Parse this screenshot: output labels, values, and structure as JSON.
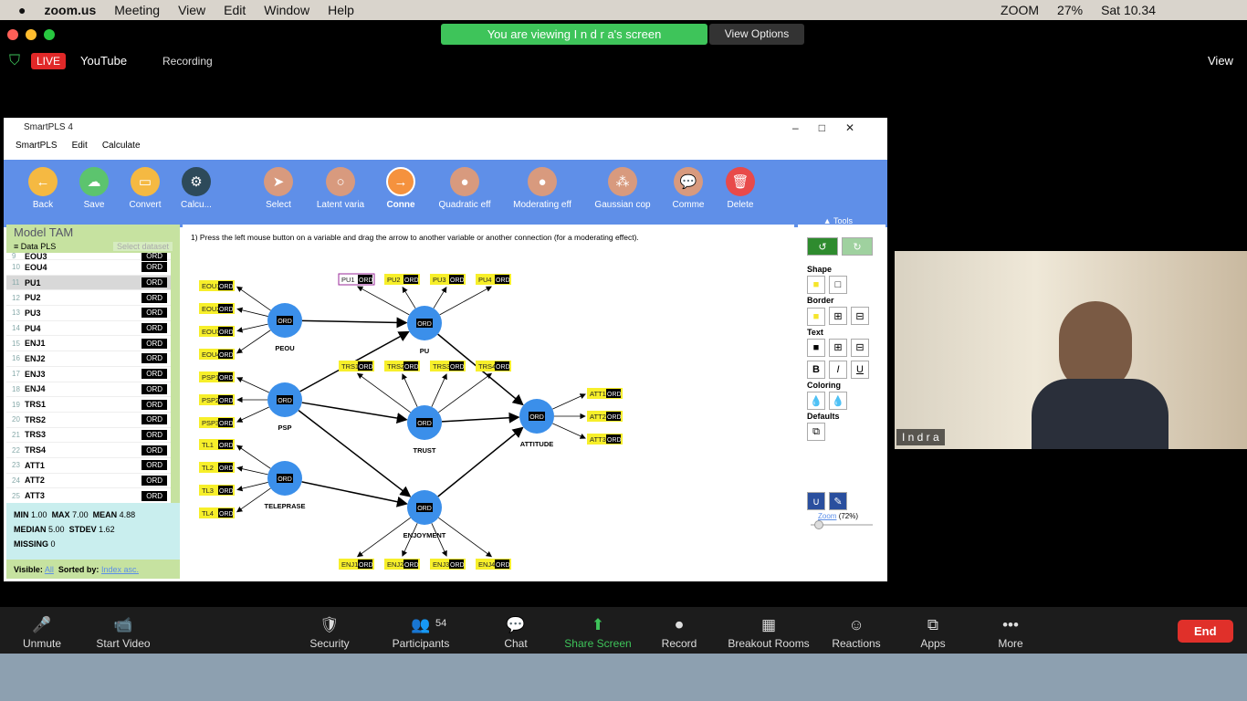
{
  "mac_menu": {
    "app": "zoom.us",
    "items": [
      "Meeting",
      "View",
      "Edit",
      "Window",
      "Help"
    ],
    "status": {
      "zoom": "ZOOM",
      "battery": "27%",
      "time": "Sat 10.34"
    }
  },
  "zoom": {
    "banner": "You are viewing I n d r a's screen",
    "view_options": "View Options",
    "live": "LIVE",
    "stream": "YouTube",
    "recording": "Recording",
    "view": "View",
    "participant": "I n d r a"
  },
  "window": {
    "title": "SmartPLS 4",
    "menu": [
      "SmartPLS",
      "Edit",
      "Calculate"
    ]
  },
  "toolbar": [
    {
      "label": "Back",
      "icon": "arrow-left-icon",
      "color": "#f5b942"
    },
    {
      "label": "Save",
      "icon": "cloud-upload-icon",
      "color": "#5cc46e"
    },
    {
      "label": "Convert",
      "icon": "document-icon",
      "color": "#f5b942"
    },
    {
      "label": "Calcu...",
      "icon": "gear-icon",
      "color": "#2d4a5a"
    },
    {
      "label": "Select",
      "icon": "cursor-icon",
      "color": "#d89a7e"
    },
    {
      "label": "Latent varia",
      "icon": "circle-icon",
      "color": "#d89a7e"
    },
    {
      "label": "Conne",
      "icon": "arrow-right-icon",
      "color": "#f5923e"
    },
    {
      "label": "Quadratic eff",
      "icon": "person-icon",
      "color": "#d89a7e"
    },
    {
      "label": "Moderating eff",
      "icon": "person-icon",
      "color": "#d89a7e"
    },
    {
      "label": "Gaussian cop",
      "icon": "group-icon",
      "color": "#d89a7e"
    },
    {
      "label": "Comme",
      "icon": "comment-icon",
      "color": "#d89a7e"
    },
    {
      "label": "Delete",
      "icon": "trash-icon",
      "color": "#e84a4a"
    }
  ],
  "tools_label": "Tools",
  "left": {
    "model": "Model TAM",
    "dataset": "Data PLS",
    "select_dataset": "Select dataset",
    "rows": [
      [
        "9",
        "EOU3"
      ],
      [
        "10",
        "EOU4"
      ],
      [
        "11",
        "PU1"
      ],
      [
        "12",
        "PU2"
      ],
      [
        "13",
        "PU3"
      ],
      [
        "14",
        "PU4"
      ],
      [
        "15",
        "ENJ1"
      ],
      [
        "16",
        "ENJ2"
      ],
      [
        "17",
        "ENJ3"
      ],
      [
        "18",
        "ENJ4"
      ],
      [
        "19",
        "TRS1"
      ],
      [
        "20",
        "TRS2"
      ],
      [
        "21",
        "TRS3"
      ],
      [
        "22",
        "TRS4"
      ],
      [
        "23",
        "ATT1"
      ],
      [
        "24",
        "ATT2"
      ],
      [
        "25",
        "ATT3"
      ]
    ],
    "type": "ORD",
    "stats": {
      "min": "1.00",
      "max": "7.00",
      "mean": "4.88",
      "median": "5.00",
      "stdev": "1.62",
      "missing": "0"
    },
    "visible_label": "Visible:",
    "visible": "All",
    "sorted_label": "Sorted by:",
    "sorted": "Index asc."
  },
  "instruction": "1) Press the left mouse button on a variable and drag the arrow to another variable or another connection (for a moderating effect).",
  "model": {
    "node_tag": "ORD",
    "latents": [
      "PEOU",
      "PU",
      "PSP",
      "TRUST",
      "TELEPRASE",
      "ENJOYMENT",
      "ATTITUDE"
    ],
    "indicators": {
      "PEOU": [
        "EOU1",
        "EOU2",
        "EOU3",
        "EOU4"
      ],
      "PSP": [
        "PSP1",
        "PSP2",
        "PSP3"
      ],
      "TELEPRASE": [
        "TL1",
        "TL2",
        "TL3",
        "TL4"
      ],
      "PU": [
        "PU1",
        "PU2",
        "PU3",
        "PU4"
      ],
      "TRUST": [
        "TRS1",
        "TRS2",
        "TRS3",
        "TRS4"
      ],
      "ENJOYMENT": [
        "ENJ1",
        "ENJ2",
        "ENJ3",
        "ENJ4"
      ],
      "ATTITUDE": [
        "ATT1",
        "ATT2",
        "ATT3"
      ]
    },
    "paths": [
      [
        "PEOU",
        "PU"
      ],
      [
        "PSP",
        "PU"
      ],
      [
        "PSP",
        "TRUST"
      ],
      [
        "PSP",
        "ENJOYMENT"
      ],
      [
        "TELEPRASE",
        "ENJOYMENT"
      ],
      [
        "PU",
        "ATTITUDE"
      ],
      [
        "TRUST",
        "ATTITUDE"
      ],
      [
        "ENJOYMENT",
        "ATTITUDE"
      ]
    ],
    "selected": "PU1"
  },
  "right": {
    "shape": "Shape",
    "border": "Border",
    "text": "Text",
    "coloring": "Coloring",
    "defaults": "Defaults",
    "zoom": "Zoom",
    "zoom_value": "(72%)"
  },
  "controls": [
    [
      "Unmute",
      "🎤"
    ],
    [
      "Start Video",
      "📹"
    ],
    [
      "Security",
      "🛡"
    ],
    [
      "Participants",
      "👥"
    ],
    [
      "Chat",
      "💬"
    ],
    [
      "Share Screen",
      "⬆"
    ],
    [
      "Record",
      "⏺"
    ],
    [
      "Breakout Rooms",
      "▦"
    ],
    [
      "Reactions",
      "☺"
    ],
    [
      "Apps",
      "⧉"
    ],
    [
      "More",
      "•••"
    ]
  ],
  "participants_count": "54",
  "end": "End"
}
